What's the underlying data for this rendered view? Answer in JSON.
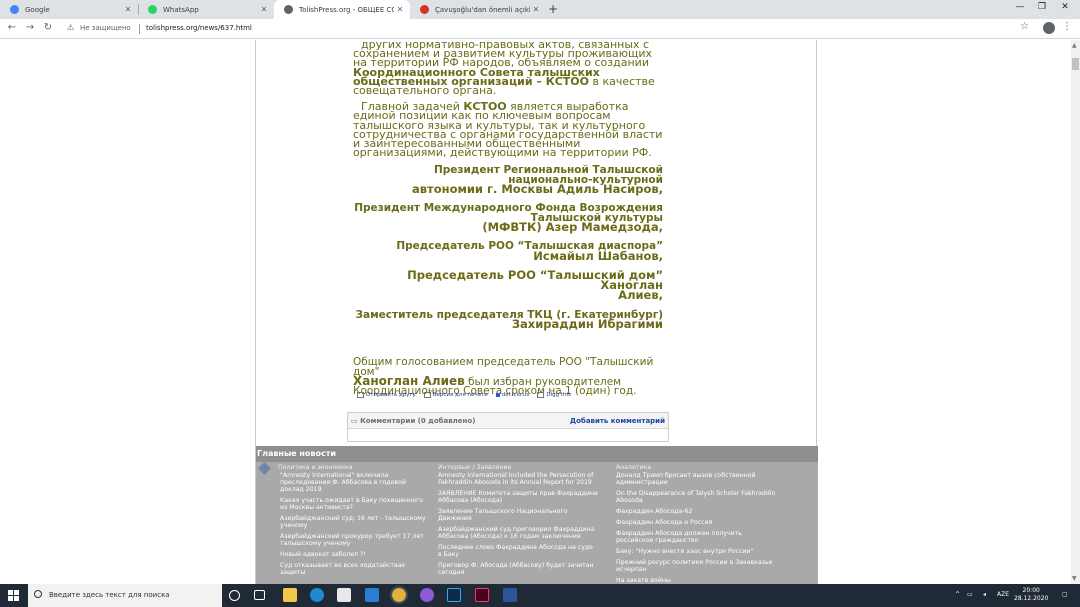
{
  "browser": {
    "tabs": [
      {
        "label": "Google",
        "icon": "google-icon",
        "color": "#4285f4",
        "active": false
      },
      {
        "label": "WhatsApp",
        "icon": "whatsapp-icon",
        "color": "#25d366",
        "active": false
      },
      {
        "label": "TolishPress.org - ОБЩЕЕ СОБРА...",
        "icon": "globe-icon",
        "color": "#5f6368",
        "active": true
      },
      {
        "label": "Çavuşoğlu'dan önemli açıklama...",
        "icon": "news-icon",
        "color": "#d93025",
        "active": false
      }
    ],
    "new_tab": "+",
    "security_label": "Не защищено",
    "url": "tolishpress.org/news/637.html"
  },
  "article": {
    "para1_a": "других нормативно-правовых актов, связанных с сохранением и развитием культуры проживающих на территории РФ  народов, объявляем о создании ",
    "para1_b": "Координационного Совета талышских общественных организаций – КСТОО",
    "para1_c": " в качестве совещательного органа.",
    "para2_a": "Главной задачей ",
    "para2_b": "КСТОО",
    "para2_c": " является выработка единой позиции как по  ключевым вопросам талышского языка и культуры, так и культурного сотрудничества с органами государственной власти и  заинтересованными общественными организациями, действующими на  территории РФ.",
    "signatures": [
      {
        "line1": "Президент Региональной Талышской национально-культурной",
        "line2": "автономии г. Москвы Адиль Насиров,"
      },
      {
        "line1": "Президент Международного Фонда Возрождения Талышской культуры",
        "line2": "(МФВТК) Азер Мамедзода,"
      },
      {
        "line1": "Председатель РОО “Талышская диаспора”",
        "line2": "Исмайыл Шабанов,"
      },
      {
        "line1": "Председатель РОО “Талышский дом” Ханоглан",
        "line2": "Алиев,"
      },
      {
        "line1": "Заместитель председателя ТКЦ (г. Екатеринбург)",
        "line2": "Захираддин Ибрагими"
      }
    ],
    "vote_a": "Общим голосованием ",
    "vote_b": "председатель РОО \"Талышский дом\"",
    "vote_c": "Ханоглан Алиев",
    "vote_d": " был избран руководителем Координационного Совета сроком на 1 (один) год."
  },
  "actions": {
    "send": "Отправить другу",
    "print": "Версия для печати",
    "delicious": "del.icio.us",
    "digg": "Digg this"
  },
  "comments": {
    "label": "Комментарии (0 добавлено)",
    "add": "Добавить комментарий"
  },
  "news": {
    "title": "Главные новости",
    "col1": {
      "title": "Политика и экономика",
      "items": [
        "\"Amnesty International\" включила преследования Ф. Аббасова в годовой доклад 2019",
        "Какая участь ожидает в Баку похищенного из Москвы активиста?",
        "Азербайджанский суд: 16 лет - талышскому ученому",
        "Азербайджанский прокурор требует 17 лет талышскому ученому",
        "Новый адвокат заболел ?!",
        "Суд отказывает во всех ходатайствах защиты"
      ]
    },
    "col2": {
      "title": "Интервью / Заявление",
      "items": [
        "Amnesty International Included the Persecution of Fakhraddin Abosoda in its Annual Report for 2019",
        "ЗАЯВЛЕНИЕ Комитета защиты прав Фахраддина Аббасова (Абосода)",
        "Заявление Талышского Национального Движения",
        "Азербайджанский суд приговорил Фахраддина Аббасова (Абосода) к 16 годам заключения",
        "Последнее слово Фахраддина Абосода на суде в Баку",
        "Приговор Ф. Абосода (Аббасову) будет зачитан сегодня"
      ]
    },
    "col3": {
      "title": "Аналитика",
      "items": [
        "Доналд Трамп бросает вызов собственной администрации",
        "On the Disappearance of Talysh Scholar Fakhraddin Abosoda",
        "Фахраддин Абосода-62",
        "Фахраддин Абосода и Россия",
        "Фахраддин Абосода должен получить российское гражданство",
        "Баку: \"Нужно внести хаос внутри России\"",
        "Прежний ресурс политики России в Закавказье исчерпан",
        "На закате войны"
      ]
    }
  },
  "taskbar": {
    "search_placeholder": "Введите здесь текст для поиска",
    "lang": "AZE",
    "time": "20:00",
    "date": "28.12.2020"
  },
  "colors": {
    "article_text": "#6b6b18",
    "link_blue": "#1c46a2",
    "news_bg": "#a9a9a9",
    "taskbar_bg": "#1f2a36"
  }
}
